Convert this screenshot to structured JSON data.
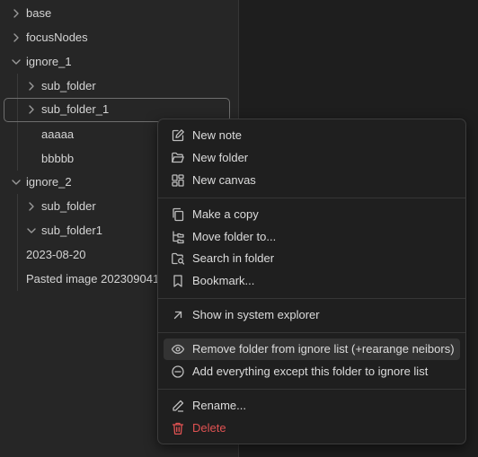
{
  "tree": {
    "items": [
      {
        "label": "base",
        "chevron": "right"
      },
      {
        "label": "focusNodes",
        "chevron": "right"
      },
      {
        "label": "ignore_1",
        "chevron": "down"
      },
      {
        "label": "sub_folder",
        "chevron": "right"
      },
      {
        "label": "sub_folder_1",
        "chevron": "right",
        "selected": true
      },
      {
        "label": "aaaaa"
      },
      {
        "label": "bbbbb"
      },
      {
        "label": "ignore_2",
        "chevron": "down"
      },
      {
        "label": "sub_folder",
        "chevron": "right"
      },
      {
        "label": "sub_folder1",
        "chevron": "down"
      },
      {
        "label": "2023-08-20"
      },
      {
        "label": "Pasted image 202309041"
      }
    ]
  },
  "context_menu": {
    "new_note": "New note",
    "new_folder": "New folder",
    "new_canvas": "New canvas",
    "make_copy": "Make a copy",
    "move_folder": "Move folder to...",
    "search_in_folder": "Search in folder",
    "bookmark": "Bookmark...",
    "show_in_explorer": "Show in system explorer",
    "remove_from_ignore": "Remove folder from ignore list (+rearange neibors)",
    "add_everything_except": "Add everything except this folder to ignore list",
    "rename": "Rename...",
    "delete": "Delete"
  },
  "colors": {
    "background": "#262626",
    "menu_background": "#1f1f1f",
    "hover": "#333333",
    "danger": "#e05252"
  }
}
